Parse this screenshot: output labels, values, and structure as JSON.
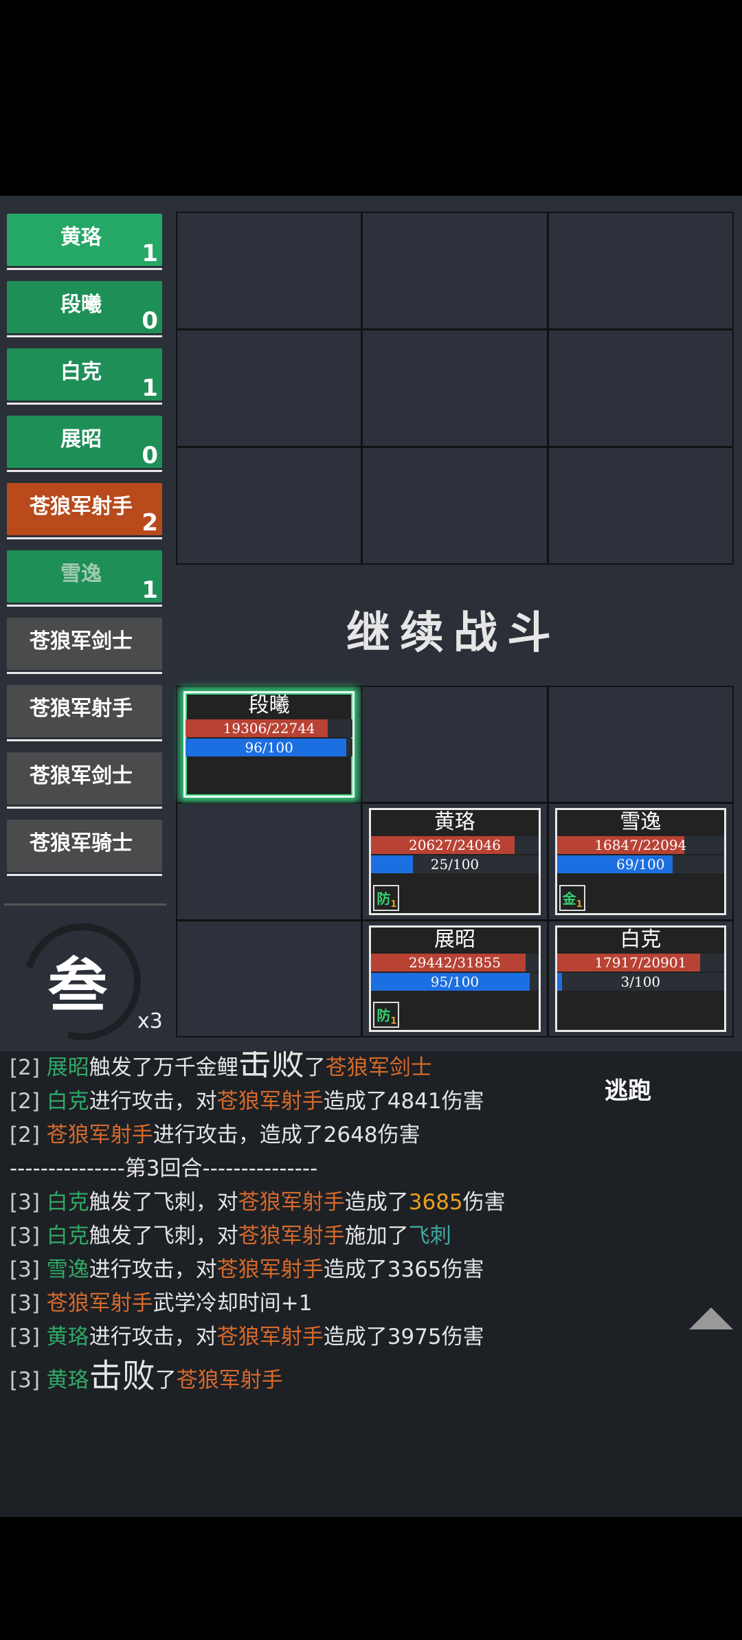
{
  "turn_order": [
    {
      "name": "黄珞",
      "count": "1",
      "style": "cur"
    },
    {
      "name": "段曦",
      "count": "0",
      "style": "green"
    },
    {
      "name": "白克",
      "count": "1",
      "style": "green"
    },
    {
      "name": "展昭",
      "count": "0",
      "style": "green"
    },
    {
      "name": "苍狼军射手",
      "count": "2",
      "style": "orange"
    },
    {
      "name": "雪逸",
      "count": "1",
      "style": "green faded"
    },
    {
      "name": "苍狼军剑士",
      "count": "",
      "style": "grey"
    },
    {
      "name": "苍狼军射手",
      "count": "",
      "style": "grey"
    },
    {
      "name": "苍狼军剑士",
      "count": "",
      "style": "grey"
    },
    {
      "name": "苍狼军骑士",
      "count": "",
      "style": "grey"
    }
  ],
  "skill": {
    "glyph": "叁",
    "multiplier": "x3"
  },
  "continue_label": "继续战斗",
  "escape_label": "逃跑",
  "units": {
    "duanxi": {
      "name": "段曦",
      "hp": "19306/22744",
      "hp_frac": 0.849,
      "mp": "96/100",
      "mp_frac": 0.96
    },
    "huangluo": {
      "name": "黄珞",
      "hp": "20627/24046",
      "hp_frac": 0.858,
      "mp": "25/100",
      "mp_frac": 0.25,
      "buff": "防",
      "buff_n": "1"
    },
    "xueyi": {
      "name": "雪逸",
      "hp": "16847/22094",
      "hp_frac": 0.763,
      "mp": "69/100",
      "mp_frac": 0.69,
      "buff": "金",
      "buff_n": "1"
    },
    "zhanzhao": {
      "name": "展昭",
      "hp": "29442/31855",
      "hp_frac": 0.924,
      "mp": "95/100",
      "mp_frac": 0.95,
      "buff": "防",
      "buff_n": "1"
    },
    "baike": {
      "name": "白克",
      "hp": "17917/20901",
      "hp_frac": 0.857,
      "mp": "3/100",
      "mp_frac": 0.03
    }
  },
  "log": {
    "l1": [
      "[2] ",
      "展昭",
      "触发了万千金鲤",
      "击败",
      "了",
      "苍狼军剑士"
    ],
    "l2": [
      "[2] ",
      "白克",
      "进行攻击，对",
      "苍狼军射手",
      "造成了4841伤害"
    ],
    "l3": [
      "[2] ",
      "苍狼军射手",
      "进行攻击，造成了2648伤害"
    ],
    "l4": "---------------第3回合---------------",
    "l5": [
      "[3] ",
      "白克",
      "触发了飞刺，对",
      "苍狼军射手",
      "造成了",
      "3685",
      "伤害"
    ],
    "l6": [
      "[3] ",
      "白克",
      "触发了飞刺，对",
      "苍狼军射手",
      "施加了",
      "飞刺"
    ],
    "l7": [
      "[3] ",
      "雪逸",
      "进行攻击，对",
      "苍狼军射手",
      "造成了3365伤害"
    ],
    "l8": [
      "[3] ",
      "苍狼军射手",
      "武学冷却时间+1"
    ],
    "l9": [
      "[3] ",
      "黄珞",
      "进行攻击，对",
      "苍狼军射手",
      "造成了3975伤害"
    ],
    "l10": [
      "[3] ",
      "黄珞",
      "击败",
      "了",
      "苍狼军射手"
    ]
  },
  "colors": {
    "ally": "#2faa65",
    "enemy": "#d66a2a",
    "highlight": "#e8a020",
    "skill": "#3fa9a0",
    "hp": "#b84234",
    "mp": "#1c6fe0"
  }
}
